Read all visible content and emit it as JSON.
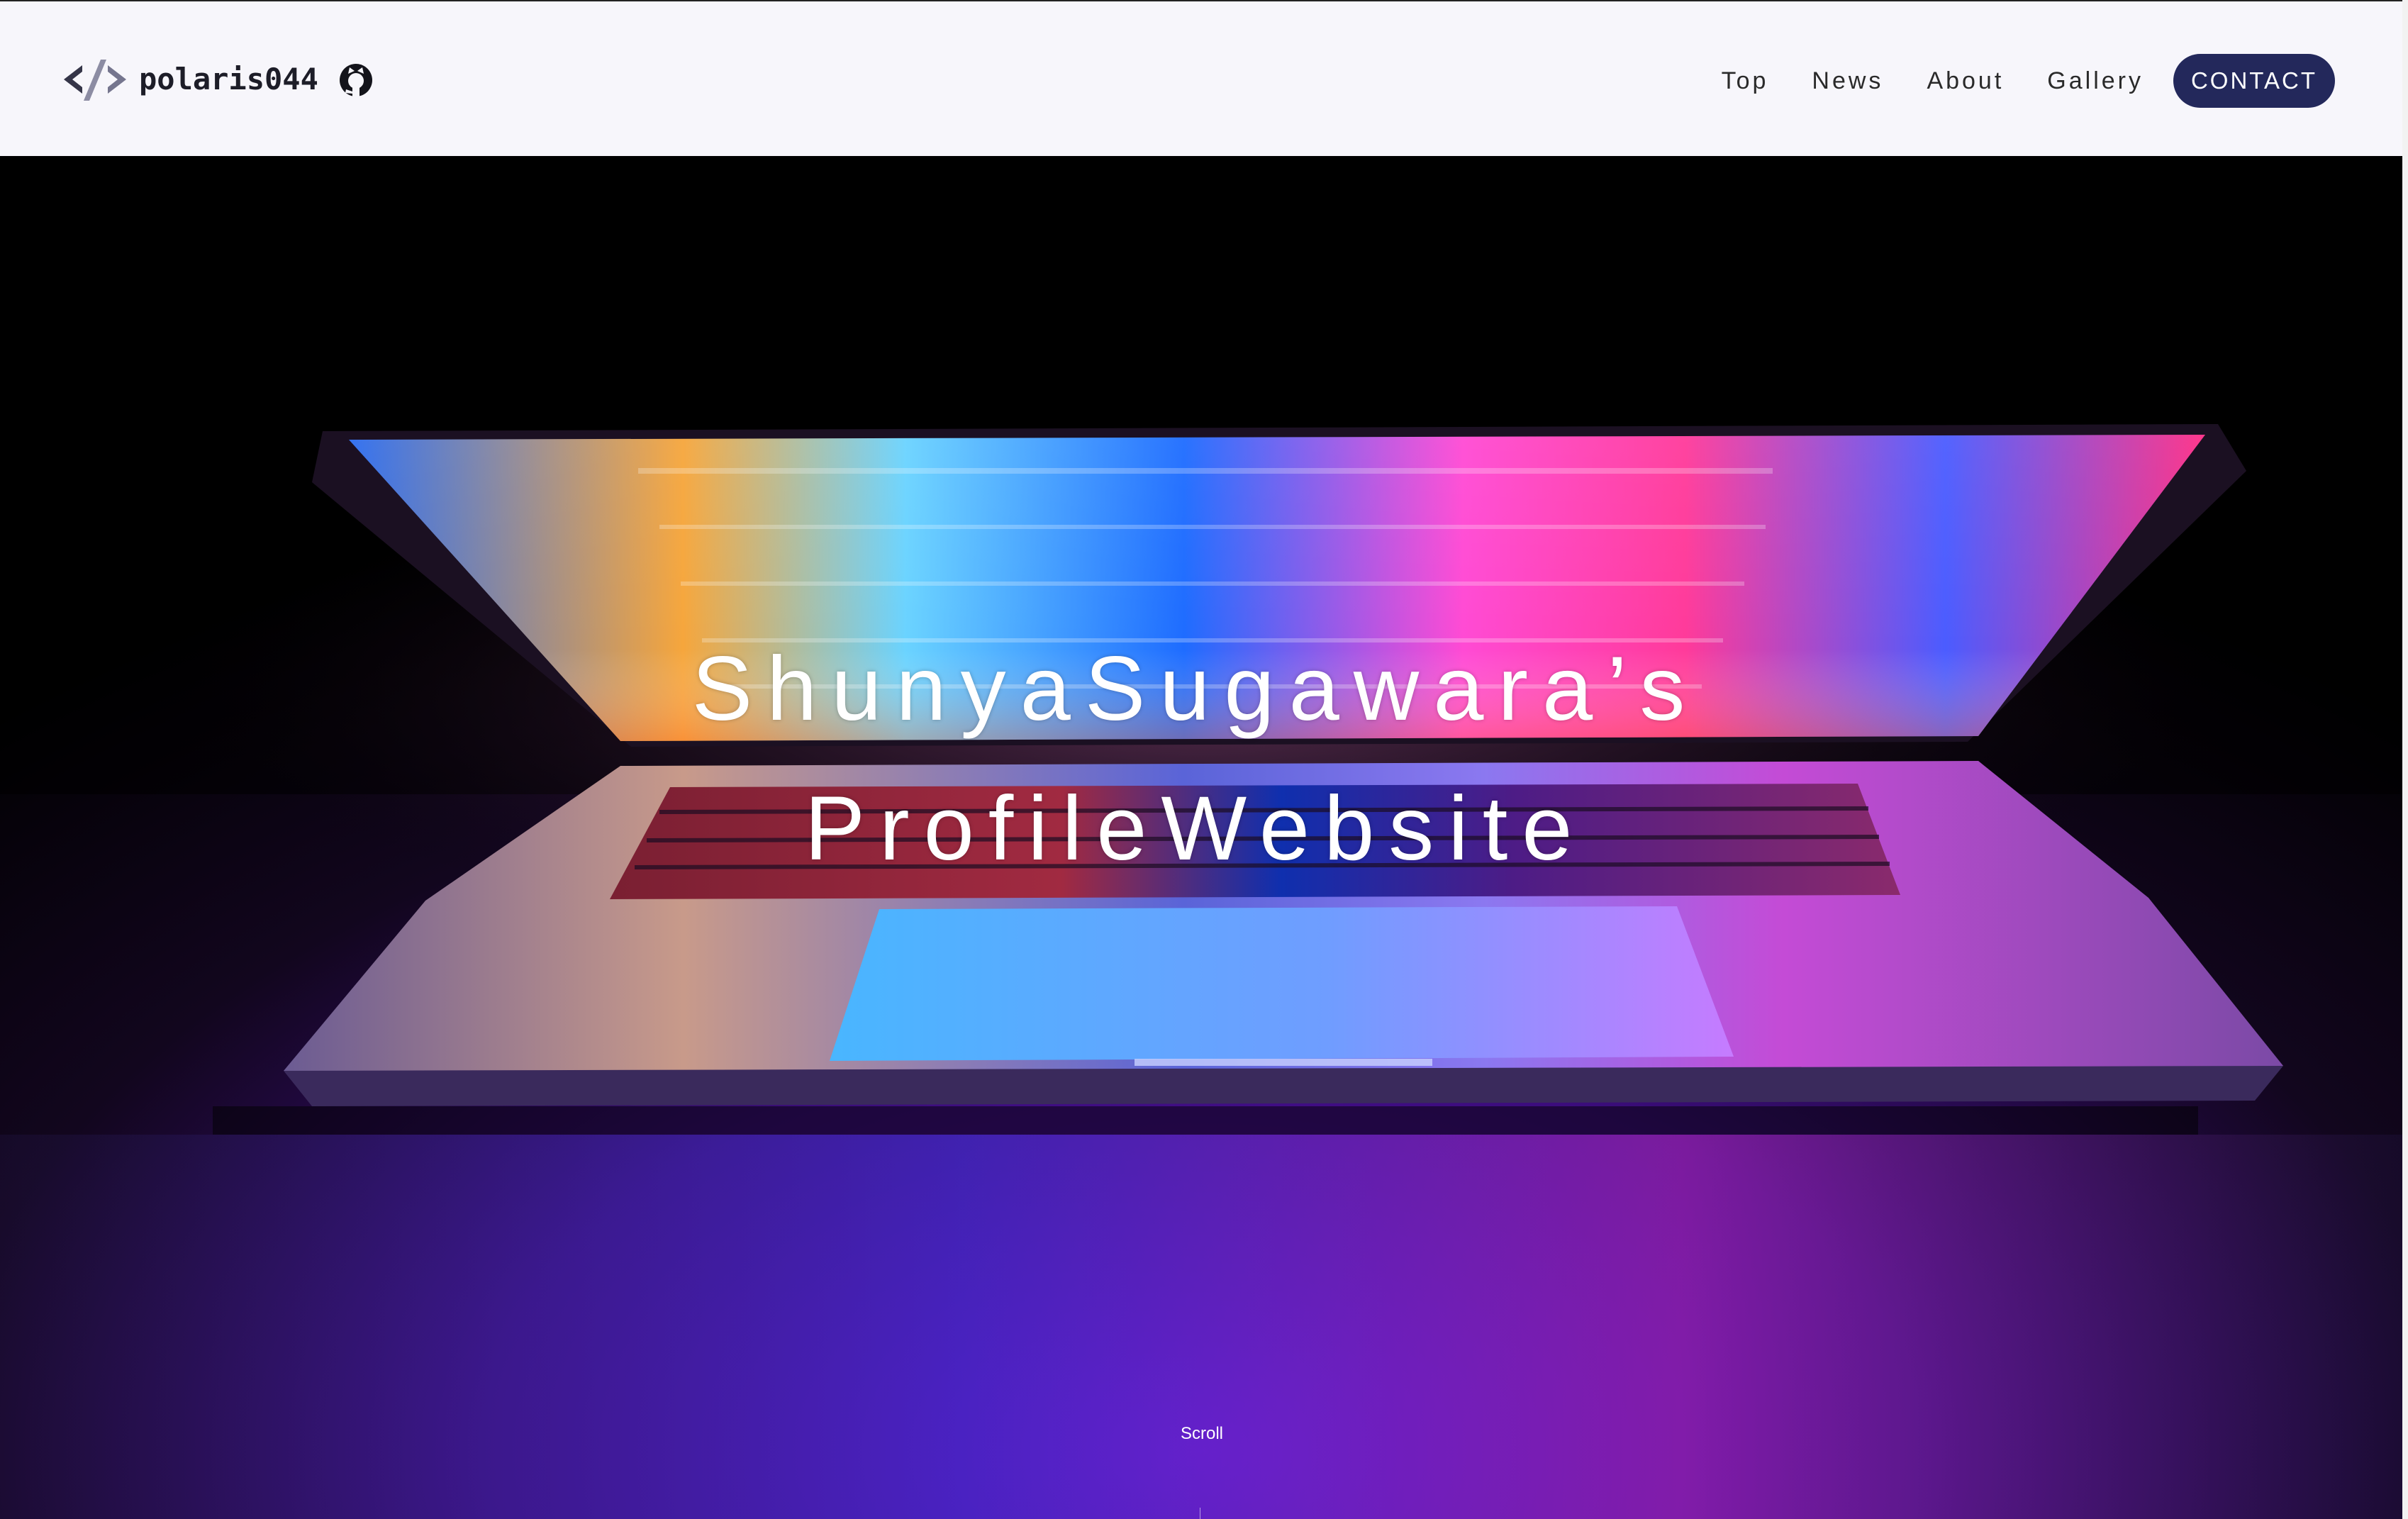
{
  "header": {
    "brand_name": "polaris044",
    "logo_icon": "code-brackets-icon",
    "github_icon": "github-icon",
    "nav_items": [
      {
        "label": "Top"
      },
      {
        "label": "News"
      },
      {
        "label": "About"
      },
      {
        "label": "Gallery"
      }
    ],
    "contact_label": "CONTACT"
  },
  "hero": {
    "title_line1": "ShunyaSugawara’s",
    "title_line2": "ProfileWebsite",
    "scroll_label": "Scroll",
    "background_image": "laptop-neon-photo"
  },
  "colors": {
    "header_bg": "#f7f6fb",
    "accent_button": "#23285b",
    "brand_text": "#1d1d28",
    "hero_text": "#ffffff"
  }
}
